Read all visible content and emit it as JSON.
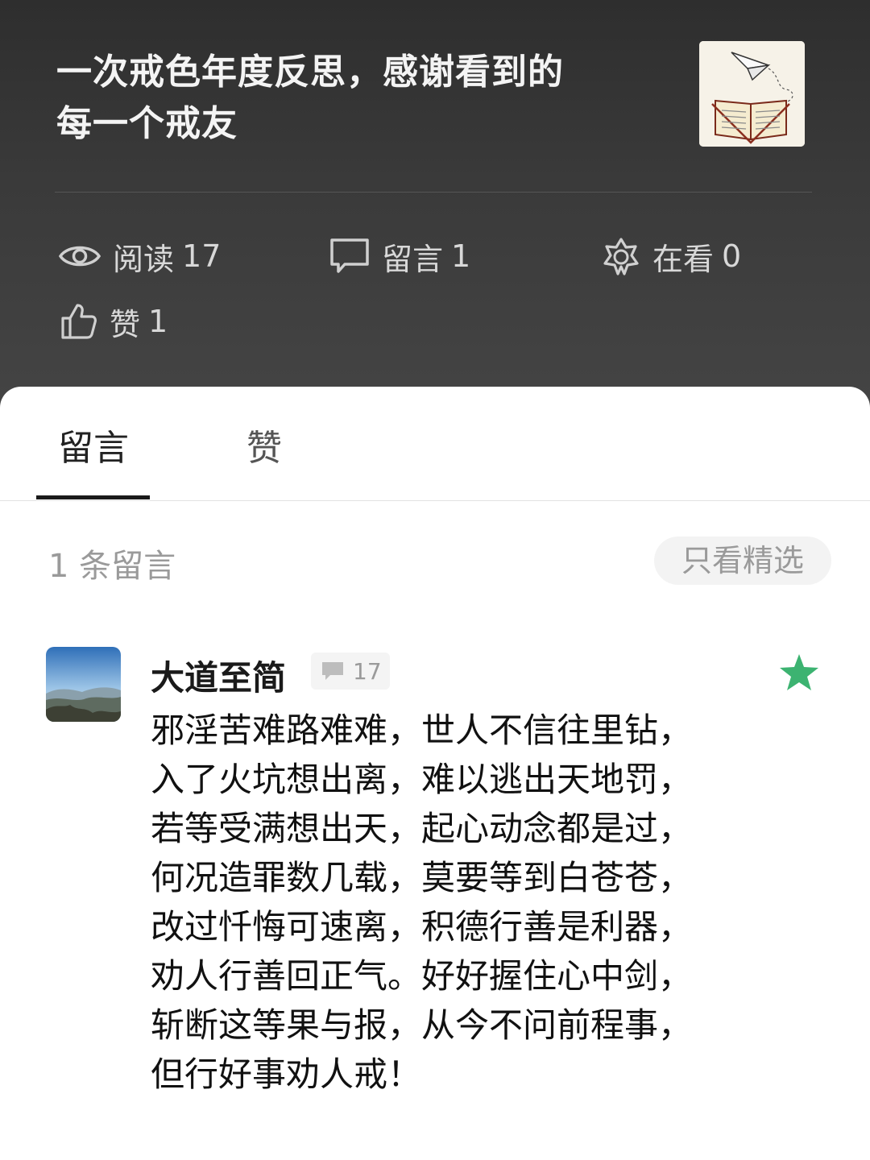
{
  "article": {
    "title_line1": "一次戒色年度反思，感谢看到的",
    "title_line2": "每一个戒友",
    "thumbnail_icon": "book-paper-plane-icon"
  },
  "stats": {
    "read_label": "阅读",
    "read_count": "17",
    "comment_label": "留言",
    "comment_count": "1",
    "watching_label": "在看",
    "watching_count": "0",
    "like_label": "赞",
    "like_count": "1"
  },
  "tabs": [
    {
      "label": "留言",
      "active": true
    },
    {
      "label": "赞",
      "active": false
    }
  ],
  "comments_section": {
    "count_text": "1 条留言",
    "filter_label": "只看精选"
  },
  "comment": {
    "author": "大道至简",
    "badge_count": "17",
    "starred": true,
    "lines": [
      "邪淫苦难路难难，世人不信往里钻，",
      "入了火坑想出离，难以逃出天地罚，",
      "若等受满想出天，起心动念都是过，",
      "何况造罪数几载，莫要等到白苍苍，",
      "改过忏悔可速离，积德行善是利器，",
      "劝人行善回正气。好好握住心中剑，",
      "斩断这等果与报，从今不问前程事，",
      "但行好事劝人戒！"
    ]
  },
  "colors": {
    "header_bg": "#3a3a3a",
    "star_green": "#3cb371",
    "panel_bg": "#ffffff"
  }
}
